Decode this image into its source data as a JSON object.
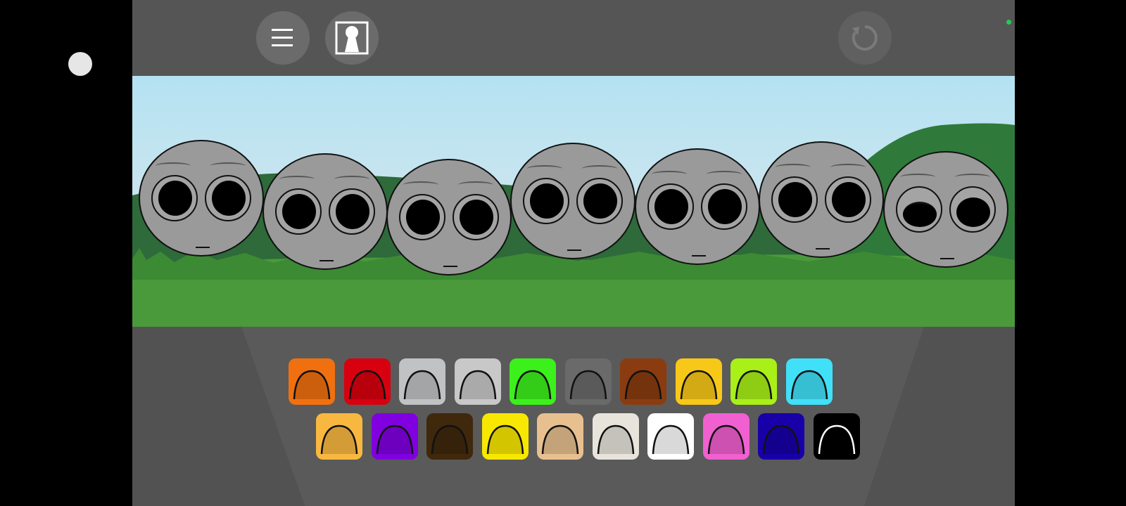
{
  "topbar": {
    "buttons": [
      {
        "name": "menu-button",
        "icon": "hamburger-menu-icon"
      },
      {
        "name": "character-portrait-button",
        "icon": "portrait-icon"
      },
      {
        "name": "reset-button",
        "icon": "refresh-icon"
      }
    ]
  },
  "characters": [
    {
      "pose": "idle"
    },
    {
      "pose": "idle"
    },
    {
      "pose": "idle"
    },
    {
      "pose": "idle"
    },
    {
      "pose": "idle"
    },
    {
      "pose": "idle"
    },
    {
      "pose": "wink"
    }
  ],
  "palette": {
    "row1": [
      {
        "name": "orange-antenna-hat",
        "color": "#f07010"
      },
      {
        "name": "red-spiky-hair",
        "color": "#d8000f"
      },
      {
        "name": "silver-ufo-hat",
        "color": "#c0c2c4"
      },
      {
        "name": "gray-robot-visor",
        "color": "#c8c8c8"
      },
      {
        "name": "green-pepper-hat",
        "color": "#3cf01c"
      },
      {
        "name": "gray-cat-ears",
        "color": "#6a6a6a"
      },
      {
        "name": "brown-bucket-hat",
        "color": "#8a3c10"
      },
      {
        "name": "yellow-cap",
        "color": "#f8c818"
      },
      {
        "name": "lime-spiky-hair",
        "color": "#a8f018"
      },
      {
        "name": "cyan-headphones",
        "color": "#40e0f8"
      }
    ],
    "row2": [
      {
        "name": "sun-crown",
        "color": "#f8b840"
      },
      {
        "name": "purple-horns",
        "color": "#8000e0"
      },
      {
        "name": "olive-bush-hair",
        "color": "#40280c"
      },
      {
        "name": "yellow-lightning",
        "color": "#f8e800"
      },
      {
        "name": "brown-hair",
        "color": "#e8c090"
      },
      {
        "name": "propeller-cap",
        "color": "#e8e4dc"
      },
      {
        "name": "white-cat-ears",
        "color": "#ffffff"
      },
      {
        "name": "pink-bunny-ears",
        "color": "#f060d0"
      },
      {
        "name": "navy-dome",
        "color": "#1800a8"
      },
      {
        "name": "black-visor",
        "color": "#000000"
      }
    ]
  },
  "colors": {
    "status_dot": "#22cc55",
    "sky": "#b4e2f2",
    "grass": "#4a9a3c"
  }
}
